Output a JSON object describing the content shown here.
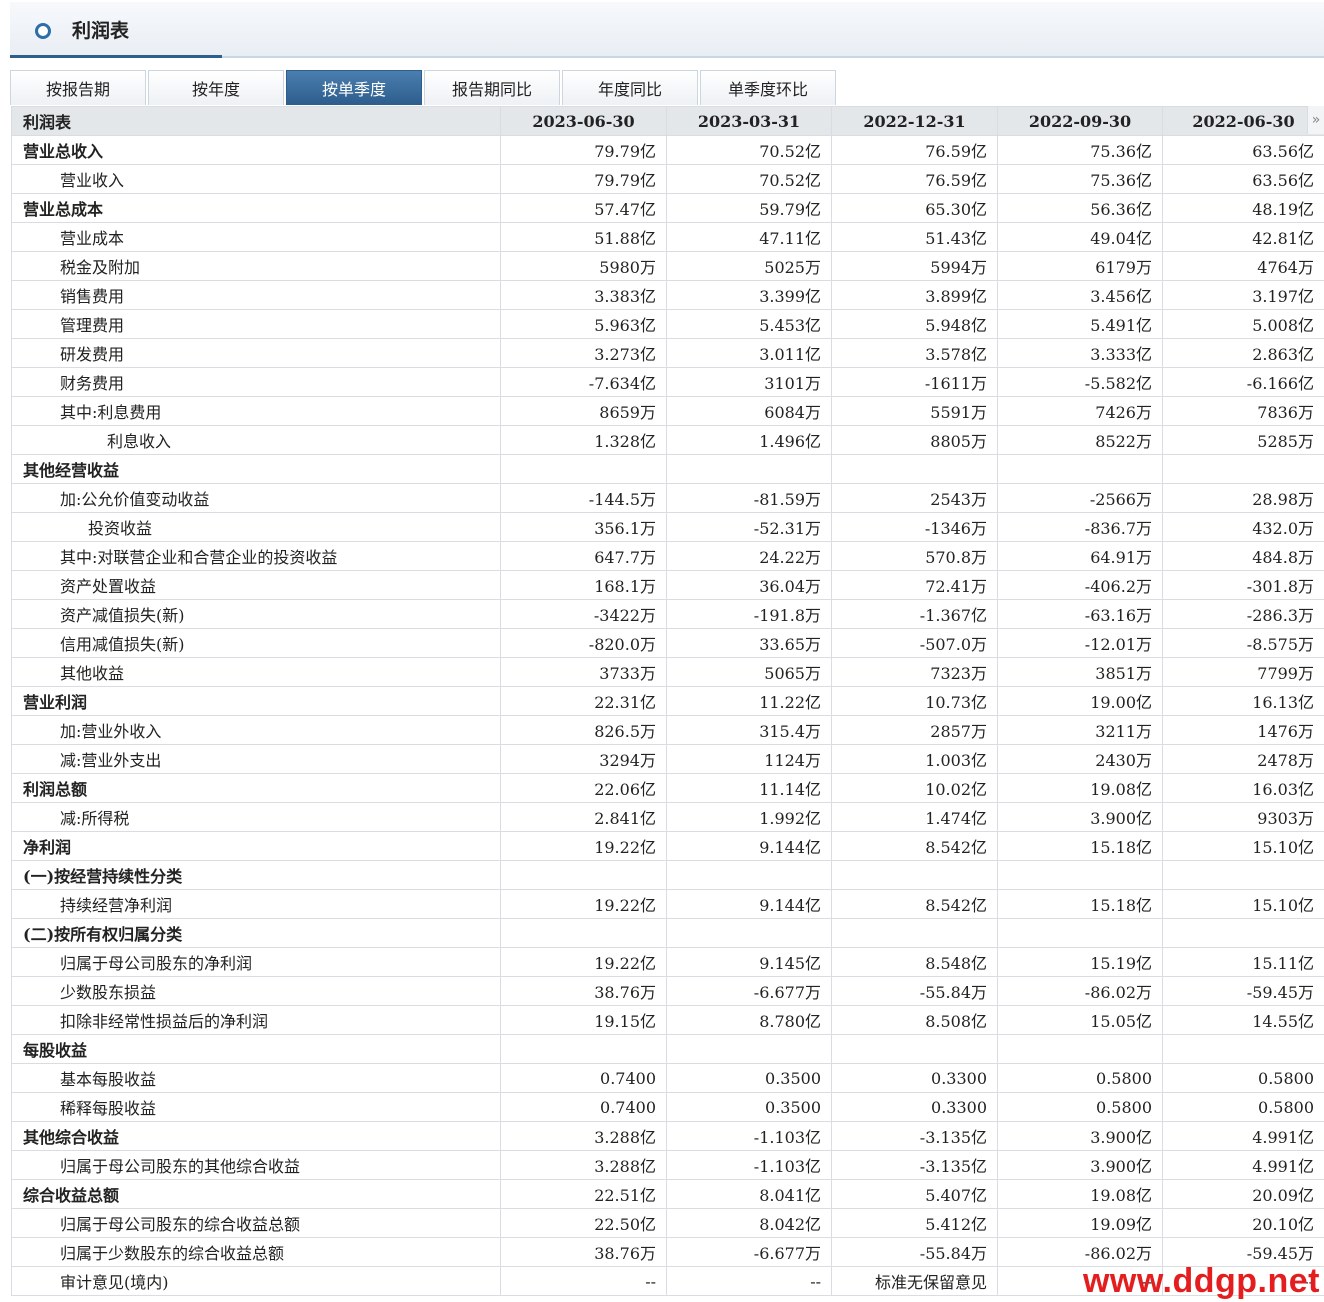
{
  "page_title": "利润表",
  "tabs": [
    "按报告期",
    "按年度",
    "按单季度",
    "报告期同比",
    "年度同比",
    "单季度环比"
  ],
  "active_tab": 2,
  "table": {
    "header_label": "利润表",
    "columns": [
      "2023-06-30",
      "2023-03-31",
      "2022-12-31",
      "2022-09-30",
      "2022-06-30"
    ],
    "scroll_glyph": "»",
    "rows": [
      {
        "label": "营业总收入",
        "level": 0,
        "bold": true,
        "values": [
          "79.79亿",
          "70.52亿",
          "76.59亿",
          "75.36亿",
          "63.56亿"
        ]
      },
      {
        "label": "营业收入",
        "level": 1,
        "bold": false,
        "values": [
          "79.79亿",
          "70.52亿",
          "76.59亿",
          "75.36亿",
          "63.56亿"
        ]
      },
      {
        "label": "营业总成本",
        "level": 0,
        "bold": true,
        "values": [
          "57.47亿",
          "59.79亿",
          "65.30亿",
          "56.36亿",
          "48.19亿"
        ]
      },
      {
        "label": "营业成本",
        "level": 1,
        "bold": false,
        "values": [
          "51.88亿",
          "47.11亿",
          "51.43亿",
          "49.04亿",
          "42.81亿"
        ]
      },
      {
        "label": "税金及附加",
        "level": 1,
        "bold": false,
        "values": [
          "5980万",
          "5025万",
          "5994万",
          "6179万",
          "4764万"
        ]
      },
      {
        "label": "销售费用",
        "level": 1,
        "bold": false,
        "values": [
          "3.383亿",
          "3.399亿",
          "3.899亿",
          "3.456亿",
          "3.197亿"
        ]
      },
      {
        "label": "管理费用",
        "level": 1,
        "bold": false,
        "values": [
          "5.963亿",
          "5.453亿",
          "5.948亿",
          "5.491亿",
          "5.008亿"
        ]
      },
      {
        "label": "研发费用",
        "level": 1,
        "bold": false,
        "values": [
          "3.273亿",
          "3.011亿",
          "3.578亿",
          "3.333亿",
          "2.863亿"
        ]
      },
      {
        "label": "财务费用",
        "level": 1,
        "bold": false,
        "values": [
          "-7.634亿",
          "3101万",
          "-1611万",
          "-5.582亿",
          "-6.166亿"
        ]
      },
      {
        "label": "其中:利息费用",
        "level": 1,
        "bold": false,
        "values": [
          "8659万",
          "6084万",
          "5591万",
          "7426万",
          "7836万"
        ]
      },
      {
        "label": "利息收入",
        "level": 3,
        "bold": false,
        "values": [
          "1.328亿",
          "1.496亿",
          "8805万",
          "8522万",
          "5285万"
        ]
      },
      {
        "label": "其他经营收益",
        "level": 0,
        "bold": true,
        "values": [
          "",
          "",
          "",
          "",
          ""
        ]
      },
      {
        "label": "加:公允价值变动收益",
        "level": 1,
        "bold": false,
        "values": [
          "-144.5万",
          "-81.59万",
          "2543万",
          "-2566万",
          "28.98万"
        ]
      },
      {
        "label": "投资收益",
        "level": 2,
        "bold": false,
        "values": [
          "356.1万",
          "-52.31万",
          "-1346万",
          "-836.7万",
          "432.0万"
        ]
      },
      {
        "label": "其中:对联营企业和合营企业的投资收益",
        "level": 1,
        "bold": false,
        "values": [
          "647.7万",
          "24.22万",
          "570.8万",
          "64.91万",
          "484.8万"
        ]
      },
      {
        "label": "资产处置收益",
        "level": 1,
        "bold": false,
        "values": [
          "168.1万",
          "36.04万",
          "72.41万",
          "-406.2万",
          "-301.8万"
        ]
      },
      {
        "label": "资产减值损失(新)",
        "level": 1,
        "bold": false,
        "values": [
          "-3422万",
          "-191.8万",
          "-1.367亿",
          "-63.16万",
          "-286.3万"
        ]
      },
      {
        "label": "信用减值损失(新)",
        "level": 1,
        "bold": false,
        "values": [
          "-820.0万",
          "33.65万",
          "-507.0万",
          "-12.01万",
          "-8.575万"
        ]
      },
      {
        "label": "其他收益",
        "level": 1,
        "bold": false,
        "values": [
          "3733万",
          "5065万",
          "7323万",
          "3851万",
          "7799万"
        ]
      },
      {
        "label": "营业利润",
        "level": 0,
        "bold": true,
        "values": [
          "22.31亿",
          "11.22亿",
          "10.73亿",
          "19.00亿",
          "16.13亿"
        ]
      },
      {
        "label": "加:营业外收入",
        "level": 1,
        "bold": false,
        "values": [
          "826.5万",
          "315.4万",
          "2857万",
          "3211万",
          "1476万"
        ]
      },
      {
        "label": "减:营业外支出",
        "level": 1,
        "bold": false,
        "values": [
          "3294万",
          "1124万",
          "1.003亿",
          "2430万",
          "2478万"
        ]
      },
      {
        "label": "利润总额",
        "level": 0,
        "bold": true,
        "values": [
          "22.06亿",
          "11.14亿",
          "10.02亿",
          "19.08亿",
          "16.03亿"
        ]
      },
      {
        "label": "减:所得税",
        "level": 1,
        "bold": false,
        "values": [
          "2.841亿",
          "1.992亿",
          "1.474亿",
          "3.900亿",
          "9303万"
        ]
      },
      {
        "label": "净利润",
        "level": 0,
        "bold": true,
        "values": [
          "19.22亿",
          "9.144亿",
          "8.542亿",
          "15.18亿",
          "15.10亿"
        ]
      },
      {
        "label": "(一)按经营持续性分类",
        "level": 0,
        "bold": true,
        "values": [
          "",
          "",
          "",
          "",
          ""
        ]
      },
      {
        "label": "持续经营净利润",
        "level": 1,
        "bold": false,
        "values": [
          "19.22亿",
          "9.144亿",
          "8.542亿",
          "15.18亿",
          "15.10亿"
        ]
      },
      {
        "label": "(二)按所有权归属分类",
        "level": 0,
        "bold": true,
        "values": [
          "",
          "",
          "",
          "",
          ""
        ]
      },
      {
        "label": "归属于母公司股东的净利润",
        "level": 1,
        "bold": false,
        "values": [
          "19.22亿",
          "9.145亿",
          "8.548亿",
          "15.19亿",
          "15.11亿"
        ]
      },
      {
        "label": "少数股东损益",
        "level": 1,
        "bold": false,
        "values": [
          "38.76万",
          "-6.677万",
          "-55.84万",
          "-86.02万",
          "-59.45万"
        ]
      },
      {
        "label": "扣除非经常性损益后的净利润",
        "level": 1,
        "bold": false,
        "values": [
          "19.15亿",
          "8.780亿",
          "8.508亿",
          "15.05亿",
          "14.55亿"
        ]
      },
      {
        "label": "每股收益",
        "level": 0,
        "bold": true,
        "values": [
          "",
          "",
          "",
          "",
          ""
        ]
      },
      {
        "label": "基本每股收益",
        "level": 1,
        "bold": false,
        "values": [
          "0.7400",
          "0.3500",
          "0.3300",
          "0.5800",
          "0.5800"
        ]
      },
      {
        "label": "稀释每股收益",
        "level": 1,
        "bold": false,
        "values": [
          "0.7400",
          "0.3500",
          "0.3300",
          "0.5800",
          "0.5800"
        ]
      },
      {
        "label": "其他综合收益",
        "level": 0,
        "bold": true,
        "values": [
          "3.288亿",
          "-1.103亿",
          "-3.135亿",
          "3.900亿",
          "4.991亿"
        ]
      },
      {
        "label": "归属于母公司股东的其他综合收益",
        "level": 1,
        "bold": false,
        "values": [
          "3.288亿",
          "-1.103亿",
          "-3.135亿",
          "3.900亿",
          "4.991亿"
        ]
      },
      {
        "label": "综合收益总额",
        "level": 0,
        "bold": true,
        "values": [
          "22.51亿",
          "8.041亿",
          "5.407亿",
          "19.08亿",
          "20.09亿"
        ]
      },
      {
        "label": "归属于母公司股东的综合收益总额",
        "level": 1,
        "bold": false,
        "values": [
          "22.50亿",
          "8.042亿",
          "5.412亿",
          "19.09亿",
          "20.10亿"
        ]
      },
      {
        "label": "归属于少数股东的综合收益总额",
        "level": 1,
        "bold": false,
        "values": [
          "38.76万",
          "-6.677万",
          "-55.84万",
          "-86.02万",
          "-59.45万"
        ]
      },
      {
        "label": "审计意见(境内)",
        "level": 1,
        "bold": false,
        "values": [
          "--",
          "--",
          "标准无保留意见",
          "--",
          "--"
        ]
      }
    ]
  },
  "watermark": "www.ddgp.net",
  "colors": {
    "accent": "#2e5f8c",
    "watermark": "#e41e1e",
    "header_bg": "#e4e7ea"
  }
}
